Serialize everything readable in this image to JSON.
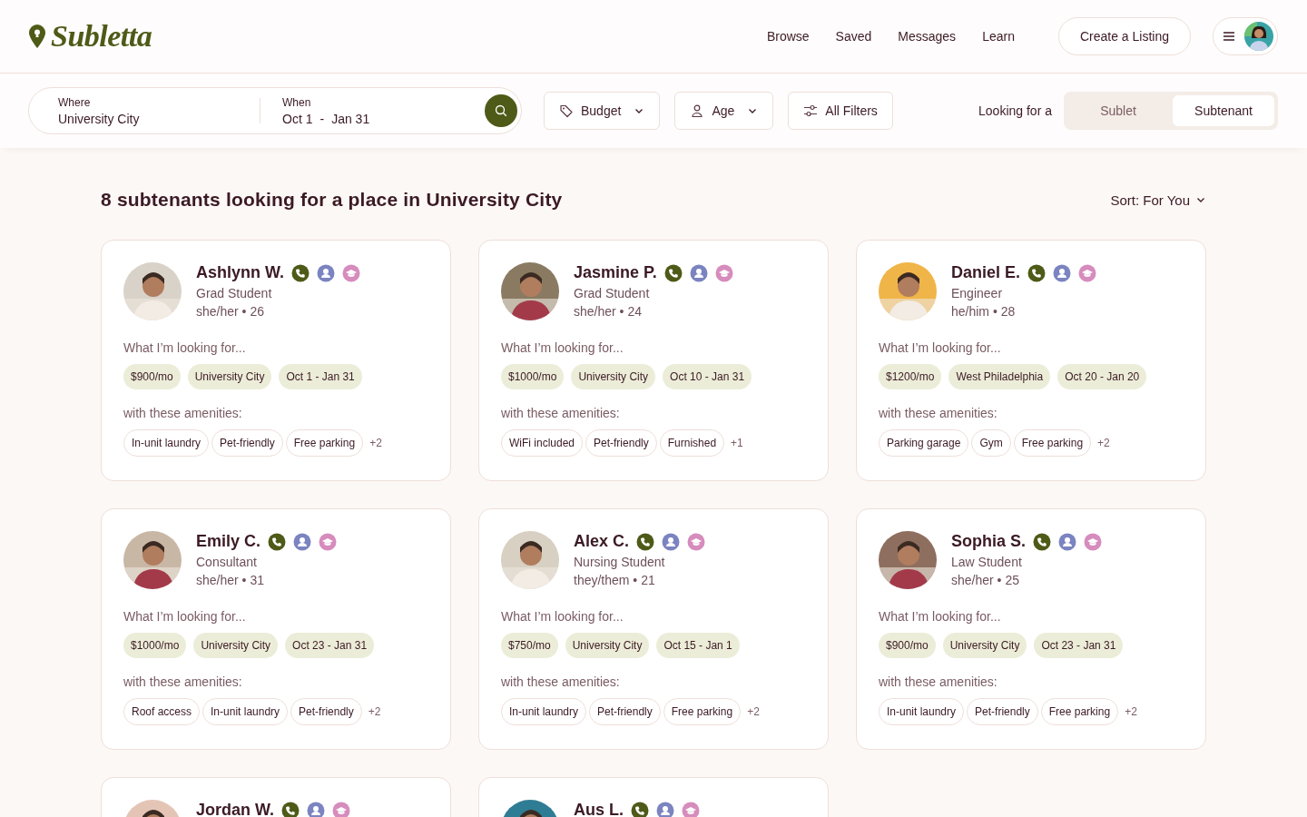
{
  "brand": {
    "name": "Subletta"
  },
  "nav": {
    "links": [
      "Browse",
      "Saved",
      "Messages",
      "Learn"
    ],
    "create_button": "Create a Listing"
  },
  "search": {
    "where_label": "Where",
    "where_value": "University City",
    "when_label": "When",
    "when_start": "Oct 1",
    "when_sep": "-",
    "when_end": "Jan 31"
  },
  "filters": [
    {
      "label": "Budget",
      "kind": "budget"
    },
    {
      "label": "Age",
      "kind": "age"
    },
    {
      "label": "All Filters",
      "kind": "filters"
    }
  ],
  "looking_for": {
    "label": "Looking for a",
    "options": [
      {
        "label": "Sublet",
        "selected": false
      },
      {
        "label": "Subtenant",
        "selected": true
      }
    ]
  },
  "results": {
    "title": "8 subtenants looking for a place in University City",
    "sort": "Sort: For You"
  },
  "cards": [
    {
      "name": "Ashlynn W.",
      "role": "Grad Student",
      "details": "she/her • 26",
      "looking_label": "What I’m looking for...",
      "wants": [
        "$900/mo",
        "University City",
        "Oct 1 - Jan 31"
      ],
      "amenities_label": "with these amenities:",
      "amenities": [
        "In-unit laundry",
        "Pet-friendly",
        "Free parking"
      ],
      "more": "+2"
    },
    {
      "name": "Jasmine P.",
      "role": "Grad Student",
      "details": "she/her • 24",
      "looking_label": "What I’m looking for...",
      "wants": [
        "$1000/mo",
        "University City",
        "Oct 10 - Jan 31"
      ],
      "amenities_label": "with these amenities:",
      "amenities": [
        "WiFi included",
        "Pet-friendly",
        "Furnished"
      ],
      "more": "+1"
    },
    {
      "name": "Daniel E.",
      "role": "Engineer",
      "details": "he/him • 28",
      "looking_label": "What I’m looking for...",
      "wants": [
        "$1200/mo",
        "West Philadelphia",
        "Oct 20 - Jan 20"
      ],
      "amenities_label": "with these amenities:",
      "amenities": [
        "Parking garage",
        "Gym",
        "Free parking"
      ],
      "more": "+2"
    },
    {
      "name": "Emily C.",
      "role": "Consultant",
      "details": "she/her • 31",
      "looking_label": "What I’m looking for...",
      "wants": [
        "$1000/mo",
        "University City",
        "Oct 23 - Jan 31"
      ],
      "amenities_label": "with these amenities:",
      "amenities": [
        "Roof access",
        "In-unit laundry",
        "Pet-friendly"
      ],
      "more": "+2"
    },
    {
      "name": "Alex C.",
      "role": "Nursing Student",
      "details": "they/them • 21",
      "looking_label": "What I’m looking for...",
      "wants": [
        "$750/mo",
        "University City",
        "Oct 15 - Jan 1"
      ],
      "amenities_label": "with these amenities:",
      "amenities": [
        "In-unit laundry",
        "Pet-friendly",
        "Free parking"
      ],
      "more": "+2"
    },
    {
      "name": "Sophia S.",
      "role": "Law Student",
      "details": "she/her • 25",
      "looking_label": "What I’m looking for...",
      "wants": [
        "$900/mo",
        "University City",
        "Oct 23 - Jan 31"
      ],
      "amenities_label": "with these amenities:",
      "amenities": [
        "In-unit laundry",
        "Pet-friendly",
        "Free parking"
      ],
      "more": "+2"
    },
    {
      "name": "Jordan W."
    },
    {
      "name": "Aus L."
    }
  ]
}
